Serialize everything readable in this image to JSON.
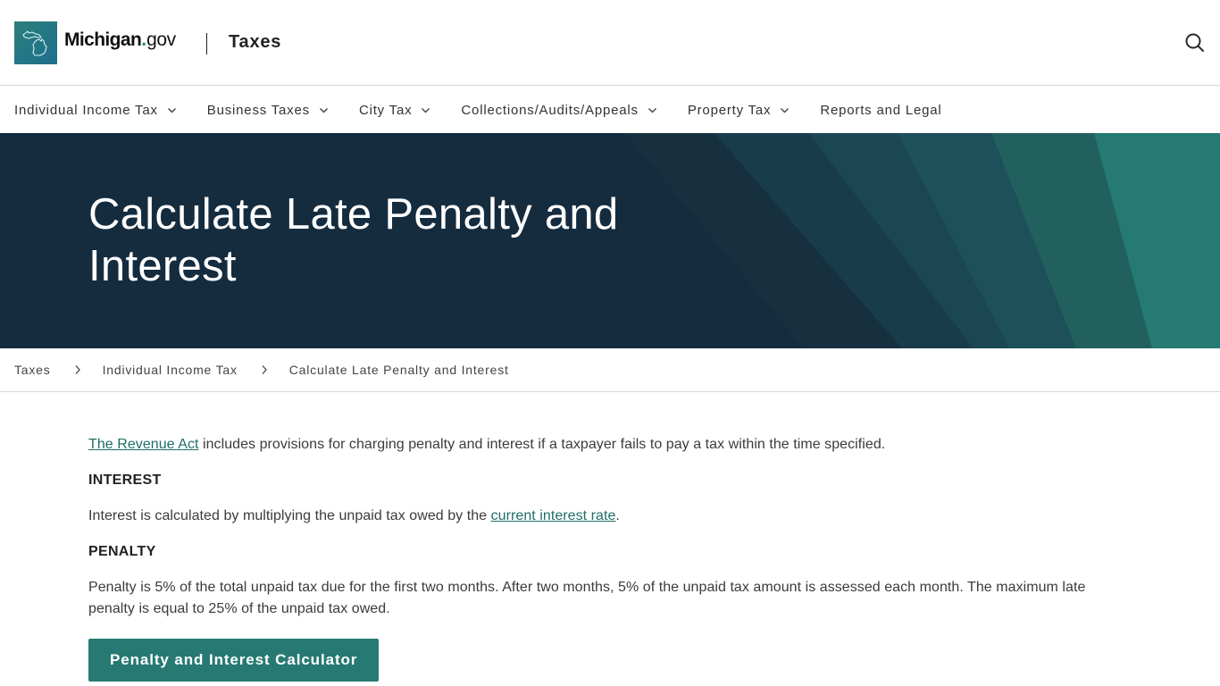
{
  "header": {
    "brand_bold": "Michigan",
    "brand_dot": ".",
    "brand_gov": "gov",
    "section_title": "Taxes",
    "logo_icon": "michigan-state-outline-icon",
    "search_icon": "search-icon"
  },
  "nav": {
    "items": [
      {
        "label": "Individual Income Tax",
        "has_dropdown": true
      },
      {
        "label": "Business Taxes",
        "has_dropdown": true
      },
      {
        "label": "City Tax",
        "has_dropdown": true
      },
      {
        "label": "Collections/Audits/Appeals",
        "has_dropdown": true
      },
      {
        "label": "Property Tax",
        "has_dropdown": true
      },
      {
        "label": "Reports and Legal",
        "has_dropdown": false
      }
    ]
  },
  "hero": {
    "title": "Calculate Late Penalty and Interest"
  },
  "breadcrumb": {
    "items": [
      {
        "label": "Taxes"
      },
      {
        "label": "Individual Income Tax"
      },
      {
        "label": "Calculate Late Penalty and Interest"
      }
    ]
  },
  "content": {
    "intro_link": "The Revenue Act",
    "intro_text": " includes provisions for charging penalty and interest if a taxpayer fails to pay a tax within the time specified.",
    "interest_heading": "INTEREST",
    "interest_text_before": "Interest is calculated by multiplying the unpaid tax owed by the ",
    "interest_link": "current interest rate",
    "interest_text_after": ".",
    "penalty_heading": "PENALTY",
    "penalty_text": "Penalty is 5% of the total unpaid tax due for the first two months. After two months, 5% of the unpaid tax amount is assessed each month. The maximum late penalty is equal to 25% of the unpaid tax owed.",
    "cta_label": "Penalty and Interest Calculator"
  },
  "colors": {
    "hero_bg": "#152c3f",
    "accent_teal": "#267a73",
    "link": "#1f6e68",
    "brand_dot": "#2a8a6d"
  }
}
